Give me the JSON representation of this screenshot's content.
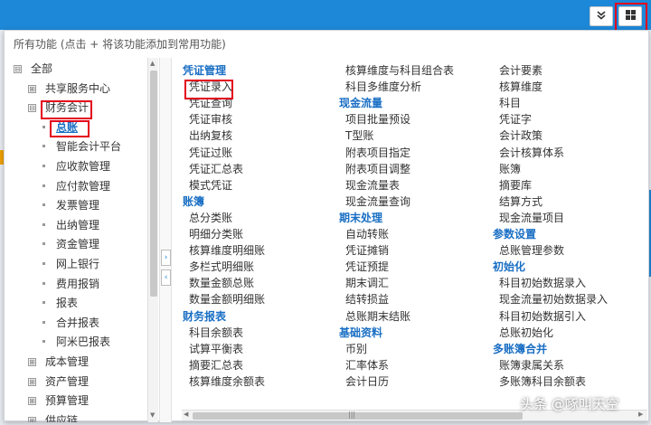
{
  "topbar": {
    "collapse_icon": "double-chevron-down",
    "grid_icon": "grid-four-squares",
    "accent": "#1e88d8"
  },
  "panel": {
    "header_tip": "所有功能  (点击 + 将该功能添加到常用功能)"
  },
  "tree": {
    "items": [
      {
        "label": "全部",
        "toggle": "⊟"
      },
      {
        "label": "共享服务中心",
        "toggle": "⊞"
      },
      {
        "label": "财务会计",
        "toggle": "⊟"
      },
      {
        "label": "总账"
      },
      {
        "label": "智能会计平台"
      },
      {
        "label": "应收款管理"
      },
      {
        "label": "应付款管理"
      },
      {
        "label": "发票管理"
      },
      {
        "label": "出纳管理"
      },
      {
        "label": "资金管理"
      },
      {
        "label": "网上银行"
      },
      {
        "label": "费用报销"
      },
      {
        "label": "报表"
      },
      {
        "label": "合并报表"
      },
      {
        "label": "阿米巴报表"
      },
      {
        "label": "成本管理",
        "toggle": "⊞"
      },
      {
        "label": "资产管理",
        "toggle": "⊞"
      },
      {
        "label": "预算管理",
        "toggle": "⊞"
      },
      {
        "label": "供应链",
        "toggle": "⊞"
      }
    ]
  },
  "columns": {
    "col1": [
      {
        "label": "凭证管理",
        "head": true
      },
      {
        "label": "凭证录入"
      },
      {
        "label": "凭证查询"
      },
      {
        "label": "凭证审核"
      },
      {
        "label": "出纳复核"
      },
      {
        "label": "凭证过账"
      },
      {
        "label": "凭证汇总表"
      },
      {
        "label": "模式凭证"
      },
      {
        "label": "账簿",
        "head": true
      },
      {
        "label": "总分类账"
      },
      {
        "label": "明细分类账"
      },
      {
        "label": "核算维度明细账"
      },
      {
        "label": "多栏式明细账"
      },
      {
        "label": "数量金额总账"
      },
      {
        "label": "数量金额明细账"
      },
      {
        "label": "财务报表",
        "head": true
      },
      {
        "label": "科目余额表"
      },
      {
        "label": "试算平衡表"
      },
      {
        "label": "摘要汇总表"
      },
      {
        "label": "核算维度余额表"
      }
    ],
    "col2": [
      {
        "label": "核算维度与科目组合表"
      },
      {
        "label": "科目多维度分析"
      },
      {
        "label": "现金流量",
        "head": true
      },
      {
        "label": "项目批量预设"
      },
      {
        "label": "T型账"
      },
      {
        "label": "附表项目指定"
      },
      {
        "label": "附表项目调整"
      },
      {
        "label": "现金流量表"
      },
      {
        "label": "现金流量查询"
      },
      {
        "label": "期末处理",
        "head": true
      },
      {
        "label": "自动转账"
      },
      {
        "label": "凭证摊销"
      },
      {
        "label": "凭证预提"
      },
      {
        "label": "期末调汇"
      },
      {
        "label": "结转损益"
      },
      {
        "label": "总账期末结账"
      },
      {
        "label": "基础资料",
        "head": true
      },
      {
        "label": "币别"
      },
      {
        "label": "汇率体系"
      },
      {
        "label": "会计日历"
      }
    ],
    "col3": [
      {
        "label": "会计要素"
      },
      {
        "label": "核算维度"
      },
      {
        "label": "科目"
      },
      {
        "label": "凭证字"
      },
      {
        "label": "会计政策"
      },
      {
        "label": "会计核算体系"
      },
      {
        "label": "账簿"
      },
      {
        "label": "摘要库"
      },
      {
        "label": "结算方式"
      },
      {
        "label": "现金流量项目"
      },
      {
        "label": "参数设置",
        "head": true
      },
      {
        "label": "总账管理参数"
      },
      {
        "label": "初始化",
        "head": true
      },
      {
        "label": "科目初始数据录入"
      },
      {
        "label": "现金流量初始数据录入"
      },
      {
        "label": "科目初始数据引入"
      },
      {
        "label": "总账初始化"
      },
      {
        "label": "多账簿合并",
        "head": true
      },
      {
        "label": "账簿隶属关系"
      },
      {
        "label": "多账簿科目余额表"
      }
    ]
  },
  "watermark": "头条 @啄叫天空"
}
